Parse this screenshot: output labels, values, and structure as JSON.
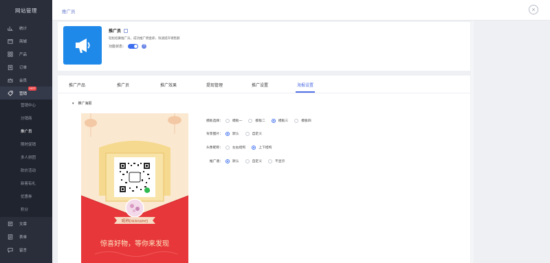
{
  "sidebar": {
    "brand": "网站管理",
    "items": [
      {
        "label": "统计",
        "icon": "chart-icon"
      },
      {
        "label": "商城",
        "icon": "store-icon"
      },
      {
        "label": "产品",
        "icon": "grid-icon"
      },
      {
        "label": "订单",
        "icon": "order-icon"
      },
      {
        "label": "会员",
        "icon": "crown-icon"
      },
      {
        "label": "营销",
        "icon": "tag-icon",
        "badge": "HOT"
      }
    ],
    "sub_items": [
      "营销中心",
      "分销商",
      "推广员",
      "限时促销",
      "多人拼团",
      "砍价活动",
      "新客有礼",
      "优惠券",
      "积分"
    ],
    "bottom_items": [
      {
        "label": "文章",
        "icon": "article-icon"
      },
      {
        "label": "表单",
        "icon": "form-icon"
      },
      {
        "label": "留言",
        "icon": "message-icon"
      }
    ]
  },
  "topbar": {
    "title": "推广员"
  },
  "app": {
    "title": "推广员",
    "desc": "轻松招募推广员，成功推广佣金即，快速提升销售额",
    "status_label": "功能状态：",
    "status_on": true
  },
  "tabs": [
    "推广产品",
    "推广员",
    "推广效果",
    "提现管理",
    "推广设置",
    "海报设置"
  ],
  "active_tab": "海报设置",
  "section": {
    "title": "推广海报"
  },
  "poster": {
    "nickname": "昵称{nickname}",
    "slogan": "惊喜好物，等你来发现"
  },
  "form": {
    "template": {
      "label": "模板选择：",
      "options": [
        "模板一",
        "模板二",
        "模板三",
        "模板四"
      ],
      "selected": "模板三"
    },
    "background": {
      "label": "背景图片：",
      "options": [
        "默认",
        "自定义"
      ],
      "selected": "默认"
    },
    "avatar_layout": {
      "label": "头像昵称：",
      "options": [
        "左右结构",
        "上下结构"
      ],
      "selected": "上下结构"
    },
    "slogan": {
      "label": "推广语：",
      "options": [
        "默认",
        "自定义",
        "不显示"
      ],
      "selected": "默认"
    }
  },
  "colors": {
    "accent": "#4f6fe5",
    "sidebar": "#2a2e3a",
    "app_icon": "#1f89ea",
    "poster_red": "#e8373a"
  }
}
